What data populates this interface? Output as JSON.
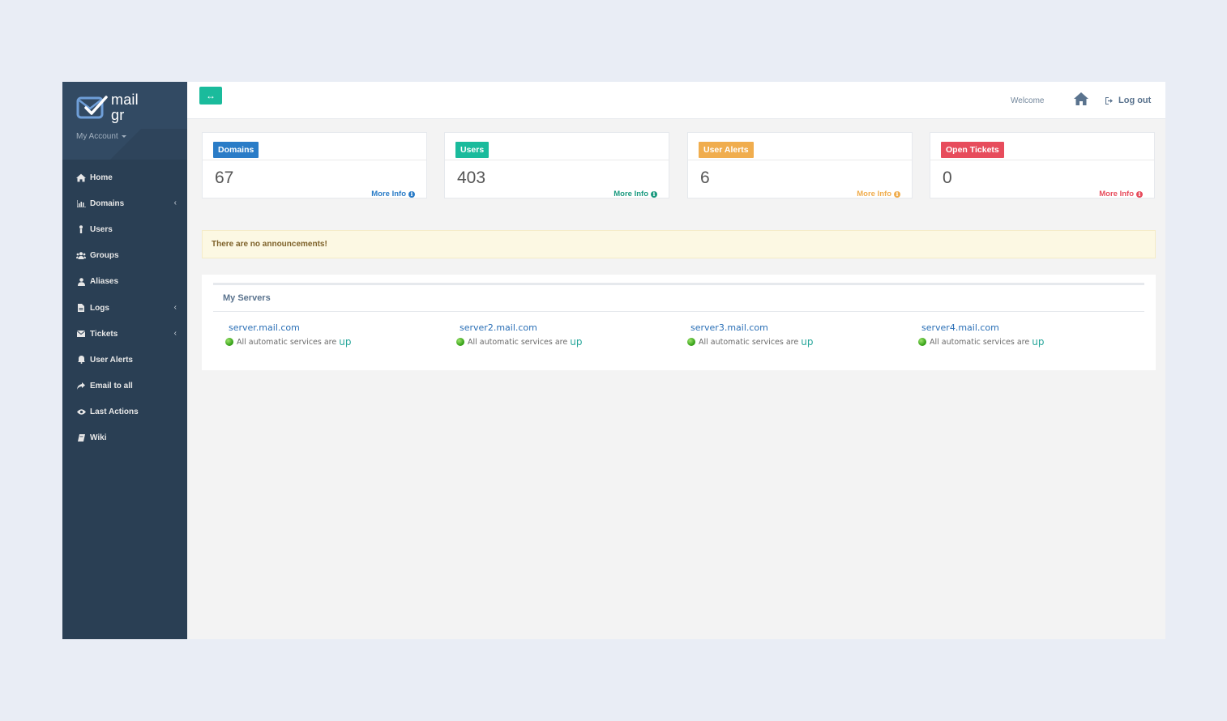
{
  "brand": {
    "line1": "mail",
    "line2": "gr",
    "account_label": "My Account"
  },
  "colors": {
    "sidebar": "#2a3f54",
    "accent_green": "#1abb9c",
    "blue": "#2a7cc7",
    "teal": "#1abb9c",
    "orange": "#f0ad4e",
    "red": "#e74c5c"
  },
  "sidebar": {
    "items": [
      {
        "label": "Home",
        "icon": "home-icon",
        "has_submenu": false
      },
      {
        "label": "Domains",
        "icon": "bar-chart-icon",
        "has_submenu": true
      },
      {
        "label": "Users",
        "icon": "user-icon",
        "has_submenu": false
      },
      {
        "label": "Groups",
        "icon": "users-icon",
        "has_submenu": false
      },
      {
        "label": "Aliases",
        "icon": "user-icon",
        "has_submenu": false
      },
      {
        "label": "Logs",
        "icon": "file-icon",
        "has_submenu": true
      },
      {
        "label": "Tickets",
        "icon": "envelope-icon",
        "has_submenu": true
      },
      {
        "label": "User Alerts",
        "icon": "bell-icon",
        "has_submenu": false
      },
      {
        "label": "Email to all",
        "icon": "share-icon",
        "has_submenu": false
      },
      {
        "label": "Last Actions",
        "icon": "eye-icon",
        "has_submenu": false
      },
      {
        "label": "Wiki",
        "icon": "book-icon",
        "has_submenu": false
      }
    ],
    "chevron": "‹"
  },
  "topbar": {
    "toggle_label": "↔",
    "welcome": "Welcome",
    "logout": "Log out"
  },
  "stats": [
    {
      "label": "Domains",
      "value": "67",
      "more": "More Info",
      "color": "#2a7cc7"
    },
    {
      "label": "Users",
      "value": "403",
      "more": "More Info",
      "color": "#1abb9c"
    },
    {
      "label": "User Alerts",
      "value": "6",
      "more": "More Info",
      "color": "#f0ad4e"
    },
    {
      "label": "Open Tickets",
      "value": "0",
      "more": "More Info",
      "color": "#e74c5c"
    }
  ],
  "announcement": "There are no announcements!",
  "servers_panel": {
    "title": "My Servers",
    "servers": [
      {
        "name": "server.mail.com",
        "status": "All automatic services are",
        "state": "up"
      },
      {
        "name": "server2.mail.com",
        "status": "All automatic services are",
        "state": "up"
      },
      {
        "name": "server3.mail.com",
        "status": "All automatic services are",
        "state": "up"
      },
      {
        "name": "server4.mail.com",
        "status": "All automatic services are",
        "state": "up"
      }
    ]
  }
}
